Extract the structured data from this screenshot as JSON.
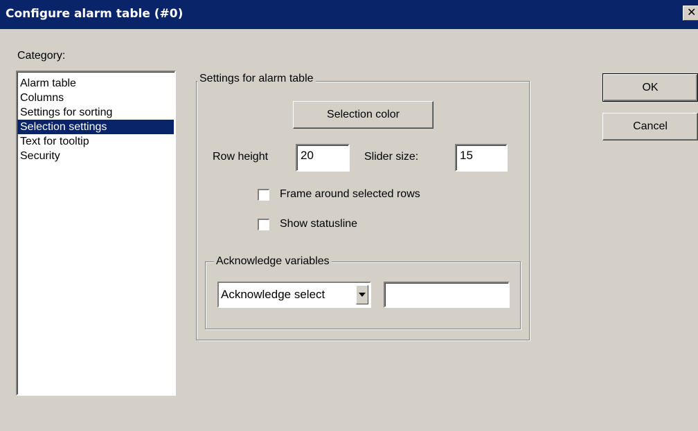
{
  "window": {
    "title": "Configure alarm table (#0)",
    "close_glyph": "✕"
  },
  "category": {
    "label": "Category:",
    "items": [
      {
        "label": "Alarm table",
        "selected": false
      },
      {
        "label": "Columns",
        "selected": false
      },
      {
        "label": "Settings for sorting",
        "selected": false
      },
      {
        "label": "Selection settings",
        "selected": true
      },
      {
        "label": "Text for tooltip",
        "selected": false
      },
      {
        "label": "Security",
        "selected": false
      }
    ]
  },
  "settings": {
    "group_label": "Settings for alarm table",
    "selection_color_button": "Selection color",
    "row_height_label": "Row height",
    "row_height_value": "20",
    "slider_size_label": "Slider size:",
    "slider_size_value": "15",
    "frame_checkbox_label": "Frame around selected rows",
    "frame_checked": false,
    "statusline_checkbox_label": "Show statusline",
    "statusline_checked": false
  },
  "acknowledge": {
    "group_label": "Acknowledge variables",
    "dropdown_value": "Acknowledge select",
    "variable_value": ""
  },
  "buttons": {
    "ok": "OK",
    "cancel": "Cancel"
  },
  "colors": {
    "titlebar": "#0a246a",
    "face": "#d4d0c8",
    "selection": "#0a246a"
  }
}
